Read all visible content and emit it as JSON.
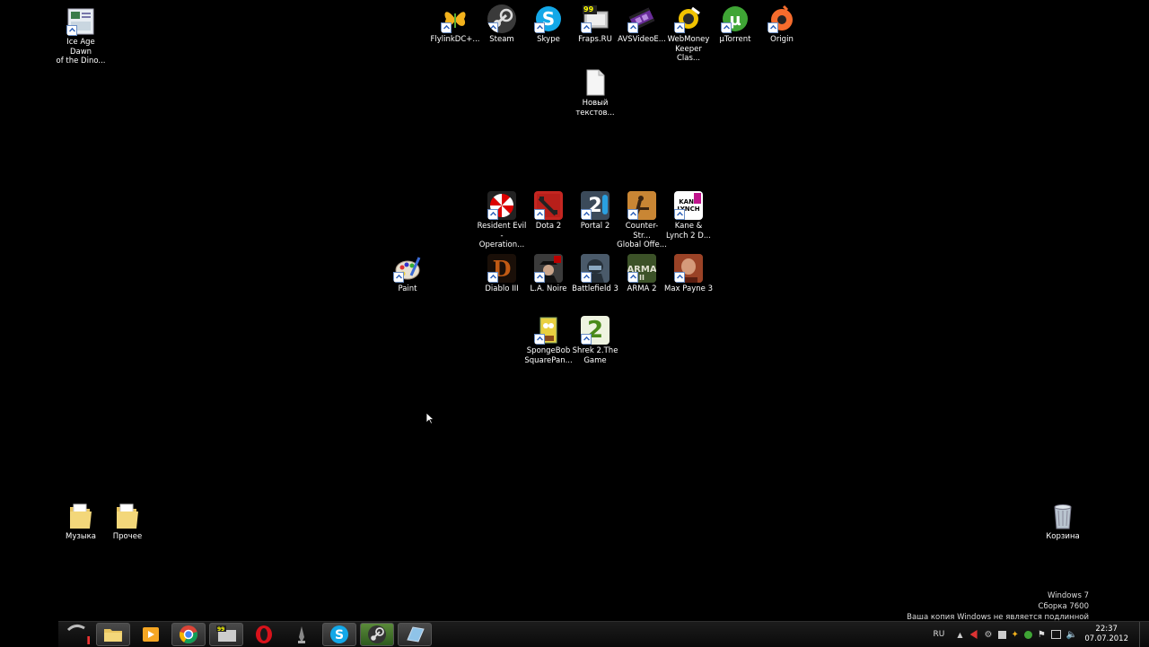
{
  "desktop": {
    "icons": {
      "iceage": "Ice Age Dawn\nof the Dino...",
      "flylink": "FlylinkDC+...",
      "steam": "Steam",
      "skype": "Skype",
      "fraps": "Fraps.RU",
      "avs": "AVSVideoE...",
      "webmoney": "WebMoney\nKeeper Clas...",
      "utorrent": "µTorrent",
      "origin": "Origin",
      "newtext": "Новый\nтекстов...",
      "resident": "Resident Evil\n- Operation...",
      "dota": "Dota 2",
      "portal": "Portal 2",
      "counter": "Counter-Str...\nGlobal Offe...",
      "kane": "Kane &\nLynch 2 D...",
      "paint": "Paint",
      "diablo": "Diablo III",
      "lanoire": "L.A. Noire",
      "bf3": "Battlefield 3",
      "arma": "ARMA 2",
      "maxpayne": "Max Payne 3",
      "sponge": "SpongeBob\nSquarePan...",
      "shrek": "Shrek 2.The\nGame",
      "music": "Музыка",
      "other": "Прочее",
      "recycle": "Корзина"
    },
    "fraps_badge": "99",
    "portal_badge": "2",
    "shrek_badge": "2",
    "kane_badge": "KANE\nLYNCH"
  },
  "watermark": {
    "line1": "Windows 7",
    "line2": "Сборка 7600",
    "line3": "Ваша копия Windows не является подлинной"
  },
  "tray": {
    "lang": "RU",
    "time": "22:37",
    "date": "07.07.2012"
  },
  "taskbar": {
    "pinned": [
      "start-icon",
      "explorer-icon",
      "media-player-icon",
      "chrome-icon",
      "fraps-icon",
      "opera-icon",
      "app-icon",
      "skype-icon",
      "steam-icon",
      "window-icon"
    ]
  },
  "colors": {
    "desktop_bg": "#000000",
    "taskbar_bg": "#141414"
  }
}
